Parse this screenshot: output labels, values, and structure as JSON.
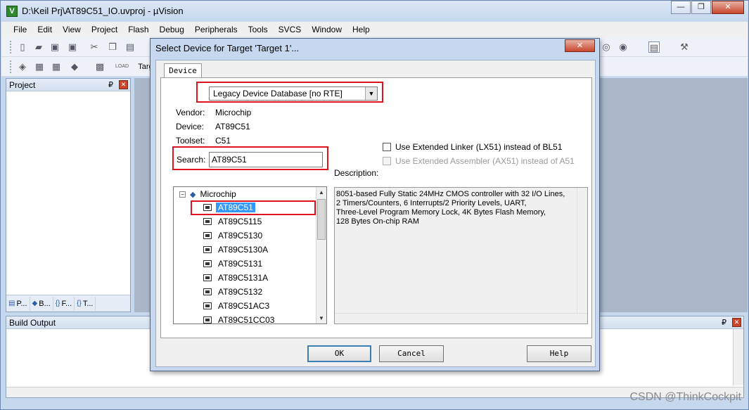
{
  "main_window": {
    "title": "D:\\Keil Prj\\AT89C51_IO.uvproj - µVision",
    "app_icon_letter": "V",
    "min_glyph": "—",
    "restore_glyph": "❐",
    "close_glyph": "✕"
  },
  "menu": [
    "File",
    "Edit",
    "View",
    "Project",
    "Flash",
    "Debug",
    "Peripherals",
    "Tools",
    "SVCS",
    "Window",
    "Help"
  ],
  "toolbar": {
    "target_truncated": "Targ"
  },
  "project_panel": {
    "title": "Project",
    "pin_glyph": "₽",
    "close_glyph": "✕",
    "tabs": [
      {
        "icon": "▤",
        "label": "P..."
      },
      {
        "icon": "◆",
        "label": "B..."
      },
      {
        "icon": "{}",
        "label": "F..."
      },
      {
        "icon": "{}",
        "label": "T..."
      }
    ]
  },
  "build_output": {
    "title": "Build Output",
    "pin_glyph": "₽",
    "close_glyph": "✕"
  },
  "watermark": "CSDN @ThinkCockpit",
  "dialog": {
    "title": "Select Device for Target 'Target 1'...",
    "close_glyph": "✕",
    "tab_label": "Device",
    "database_select": "Legacy Device Database [no RTE]",
    "dropdown_glyph": "▼",
    "vendor_label": "Vendor:",
    "vendor_value": "Microchip",
    "device_label": "Device:",
    "device_value": "AT89C51",
    "toolset_label": "Toolset:",
    "toolset_value": "C51",
    "search_label": "Search:",
    "search_value": "AT89C51",
    "use_lx51": "Use Extended Linker (LX51) instead of BL51",
    "use_ax51": "Use Extended Assembler (AX51) instead of A51",
    "description_label": "Description:",
    "description_text": "8051-based Fully Static 24MHz CMOS controller with 32  I/O Lines,\n2 Timers/Counters, 6 Interrupts/2 Priority Levels, UART,\nThree-Level Program Memory Lock, 4K Bytes Flash Memory,\n128 Bytes On-chip RAM",
    "tree": {
      "vendor": "Microchip",
      "toggle": "−",
      "devices": [
        "AT89C51",
        "AT89C5115",
        "AT89C5130",
        "AT89C5130A",
        "AT89C5131",
        "AT89C5131A",
        "AT89C5132",
        "AT89C51AC3",
        "AT89C51CC03"
      ],
      "selected_index": 0,
      "scroll_up": "▲",
      "scroll_down": "▼"
    },
    "buttons": {
      "ok": "OK",
      "cancel": "Cancel",
      "help": "Help"
    }
  }
}
